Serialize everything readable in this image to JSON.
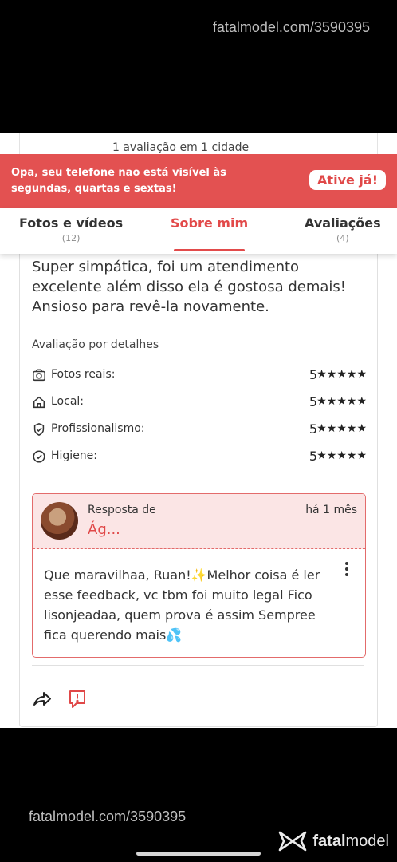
{
  "watermark": {
    "top": "fatalmodel.com/3590395",
    "bottom": "fatalmodel.com/3590395"
  },
  "brand": {
    "bold": "fatal",
    "rest": "model"
  },
  "peek": {
    "text": "1 avaliação em 1 cidade"
  },
  "banner": {
    "message": "Opa, seu telefone não está visível às segundas, quartas e sextas!",
    "button": "Ative já!",
    "color": "#e35151"
  },
  "tabs": [
    {
      "label": "Fotos e vídeos",
      "count": "(12)"
    },
    {
      "label": "Sobre mim",
      "count": ""
    },
    {
      "label": "Avaliações",
      "count": "(4)"
    }
  ],
  "review": {
    "text": "Super simpática, foi um atendimento excelente além disso ela é gostosa demais! Ansioso para revê-la novamente.",
    "details_title": "Avaliação por detalhes",
    "details": [
      {
        "label": "Fotos reais:",
        "score": "5",
        "stars": "★★★★★",
        "icon": "camera-icon"
      },
      {
        "label": "Local:",
        "score": "5",
        "stars": "★★★★★",
        "icon": "home-icon"
      },
      {
        "label": "Profissionalismo:",
        "score": "5",
        "stars": "★★★★★",
        "icon": "badge-check-icon"
      },
      {
        "label": "Higiene:",
        "score": "5",
        "stars": "★★★★★",
        "icon": "check-circle-icon"
      }
    ]
  },
  "reply": {
    "label": "Resposta de",
    "name": "Ág...",
    "time": "há 1 mês",
    "body": "Que maravilhaa, Ruan!✨Melhor coisa é ler esse feedback, vc tbm foi muito legal Fico lisonjeadaa, quem prova é assim Sempree fica querendo mais💦"
  },
  "accent_color": "#e24a4a"
}
